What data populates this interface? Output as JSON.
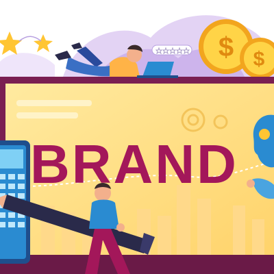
{
  "headline": "BRAND",
  "colors": {
    "brand_text": "#a3175a",
    "screen": "#ffe082",
    "frame": "#7a1f52",
    "coin": "#ffc533",
    "sky": "#d9c6f0",
    "star": "#ffc533",
    "calculator": "#2a8bd1",
    "pencil": "#2a2a4a"
  },
  "rating_stars": 5,
  "icons": [
    "star-icon",
    "coin-dollar-icon",
    "gear-icon",
    "laptop-icon",
    "calculator-icon",
    "pencil-icon",
    "head-profile-icon"
  ]
}
